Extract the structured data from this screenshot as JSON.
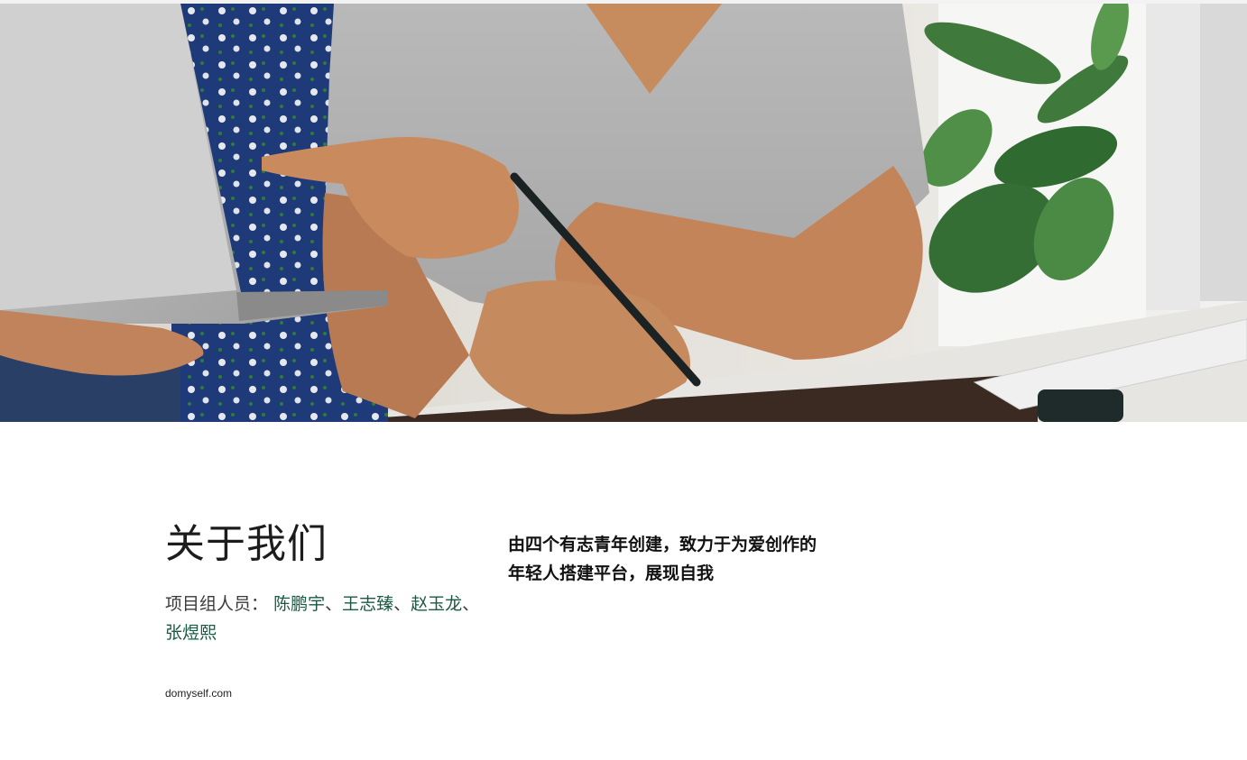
{
  "hero": {
    "image_description_icon": "hero-photo"
  },
  "about": {
    "title": "关于我们",
    "members_label": "项目组人员：",
    "members": [
      "陈鹏宇",
      "王志臻",
      "赵玉龙",
      "张煜熙"
    ],
    "separator": "、"
  },
  "tagline": {
    "line1": "由四个有志青年创建，致力于为爱创作的",
    "line2": "年轻人搭建平台，展现自我"
  },
  "footer": {
    "domain": "domyself.com"
  },
  "colors": {
    "member_name": "#1a5a44",
    "title": "#1c1c1c"
  }
}
